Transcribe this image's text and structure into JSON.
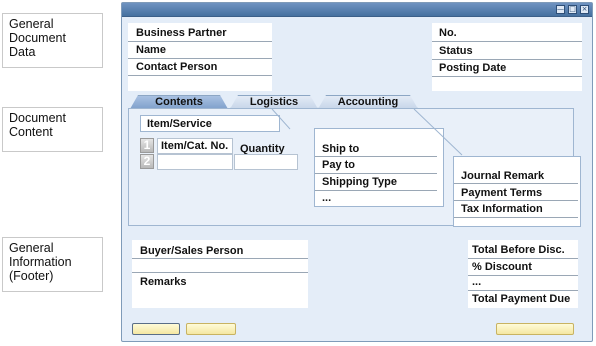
{
  "callouts": {
    "header": [
      "General",
      "Document",
      "Data"
    ],
    "content": [
      "Document",
      "Content"
    ],
    "footer": [
      "General",
      "Information",
      "(Footer)"
    ]
  },
  "header_left": {
    "business_partner": "Business Partner",
    "name": "Name",
    "contact_person": "Contact Person"
  },
  "header_right": {
    "no": "No.",
    "status": "Status",
    "posting_date": "Posting Date"
  },
  "tabs": [
    {
      "label": "Contents",
      "active": true
    },
    {
      "label": "Logistics",
      "active": false
    },
    {
      "label": "Accounting",
      "active": false
    }
  ],
  "contents": {
    "item_service_label": "Item/Service",
    "columns": [
      "Item/Cat. No.",
      "Quantity"
    ],
    "row_numbers": [
      "1",
      "2"
    ]
  },
  "logistics": {
    "rows": [
      "Ship to",
      "Pay to",
      "Shipping Type",
      "..."
    ]
  },
  "accounting": {
    "rows": [
      "Journal Remark",
      "Payment Terms",
      "Tax Information"
    ]
  },
  "footer_left": {
    "buyer": "Buyer/Sales Person",
    "remarks": "Remarks"
  },
  "footer_right": {
    "rows": [
      "Total Before Disc.",
      "% Discount",
      "...",
      "Total Payment Due"
    ]
  },
  "colors": {
    "window_bg": "#e4edf8",
    "titlebar": "#45709f",
    "button": "#f5e7a2"
  }
}
